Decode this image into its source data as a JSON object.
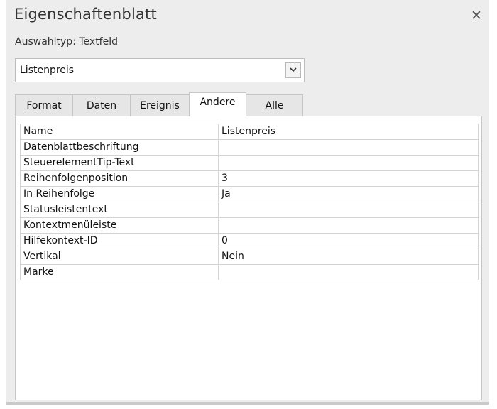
{
  "window": {
    "title": "Eigenschaftenblatt",
    "close_glyph": "✕",
    "selection_type": "Auswahltyp:  Textfeld"
  },
  "object_select": {
    "value": "Listenpreis"
  },
  "tabs": [
    {
      "label": "Format",
      "active": false
    },
    {
      "label": "Daten",
      "active": false
    },
    {
      "label": "Ereignis",
      "active": false
    },
    {
      "label": "Andere",
      "active": true
    },
    {
      "label": "Alle",
      "active": false
    }
  ],
  "properties": [
    {
      "name": "Name",
      "value": "Listenpreis"
    },
    {
      "name": "Datenblattbeschriftung",
      "value": ""
    },
    {
      "name": "SteuerelementTip-Text",
      "value": ""
    },
    {
      "name": "Reihenfolgenposition",
      "value": "3"
    },
    {
      "name": "In Reihenfolge",
      "value": "Ja"
    },
    {
      "name": "Statusleistentext",
      "value": ""
    },
    {
      "name": "Kontextmenüleiste",
      "value": ""
    },
    {
      "name": "Hilfekontext-ID",
      "value": "0"
    },
    {
      "name": "Vertikal",
      "value": "Nein"
    },
    {
      "name": "Marke",
      "value": ""
    }
  ]
}
